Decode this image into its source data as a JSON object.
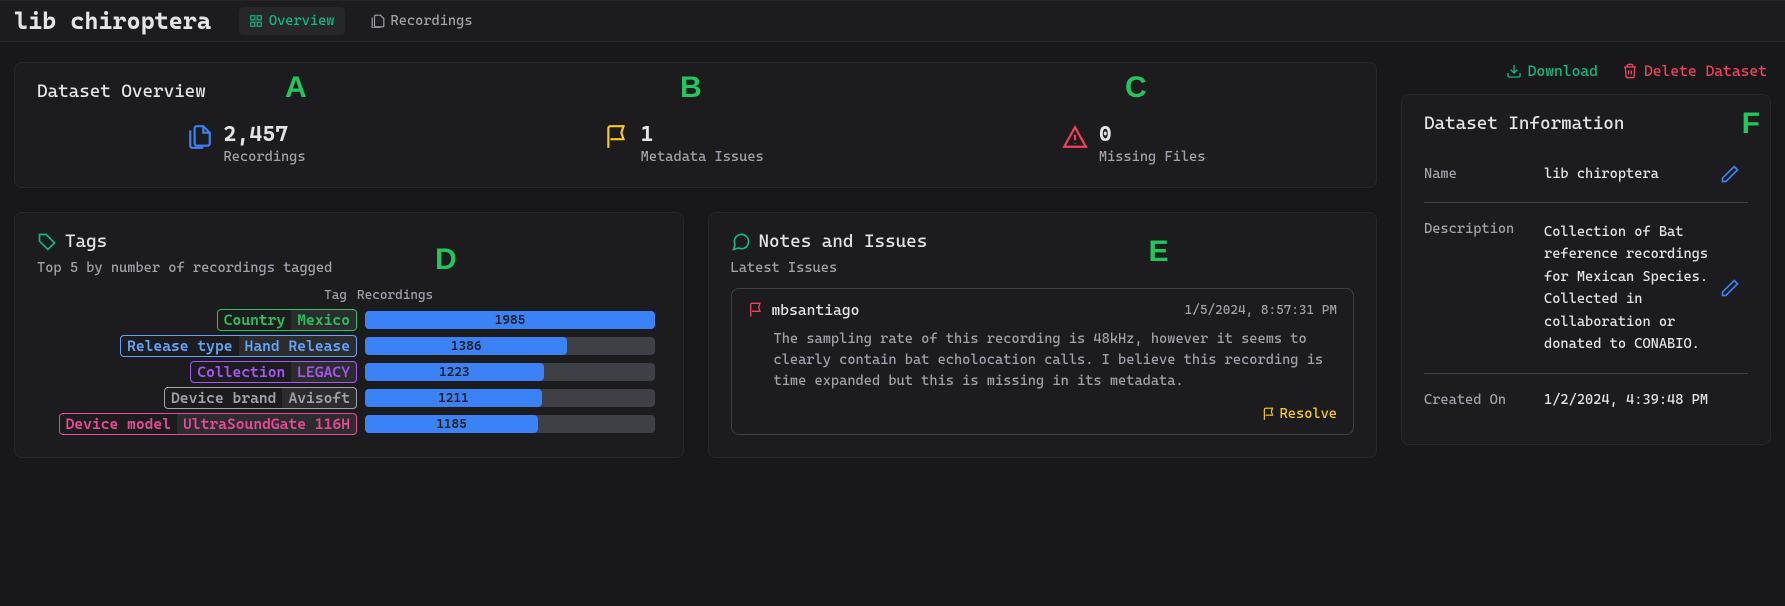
{
  "header": {
    "title": "lib chiroptera",
    "tabs": [
      {
        "label": "Overview",
        "active": true
      },
      {
        "label": "Recordings",
        "active": false
      }
    ]
  },
  "overview": {
    "title": "Dataset Overview",
    "stats": [
      {
        "value": "2,457",
        "label": "Recordings"
      },
      {
        "value": "1",
        "label": "Metadata Issues"
      },
      {
        "value": "0",
        "label": "Missing Files"
      }
    ]
  },
  "tags": {
    "title": "Tags",
    "subtitle": "Top 5 by number of recordings tagged",
    "col_tag": "Tag",
    "col_rec": "Recordings",
    "items": [
      {
        "key": "Country",
        "val": "Mexico",
        "count": 1985,
        "color": "#22c55e"
      },
      {
        "key": "Release type",
        "val": "Hand Release",
        "count": 1386,
        "color": "#60a5fa"
      },
      {
        "key": "Collection",
        "val": "LEGACY",
        "count": 1223,
        "color": "#a855f7"
      },
      {
        "key": "Device brand",
        "val": "Avisoft",
        "count": 1211,
        "color": "#a1a1aa"
      },
      {
        "key": "Device model",
        "val": "UltraSoundGate 116H",
        "count": 1185,
        "color": "#ec4899"
      }
    ]
  },
  "notes": {
    "title": "Notes and Issues",
    "subtitle": "Latest Issues",
    "issue": {
      "user": "mbsantiago",
      "date": "1/5/2024, 8:57:31 PM",
      "body": "The sampling rate of this recording is 48kHz, however it seems to clearly contain bat echolocation calls. I believe this recording is time expanded but this is missing in its metadata.",
      "resolve": "Resolve"
    }
  },
  "actions": {
    "download": "Download",
    "delete": "Delete Dataset"
  },
  "info": {
    "title": "Dataset Information",
    "name_label": "Name",
    "name_value": "lib chiroptera",
    "desc_label": "Description",
    "desc_value": "Collection of Bat reference recordings for Mexican Species. Collected in collaboration or donated to CONABIO.",
    "created_label": "Created On",
    "created_value": "1/2/2024, 4:39:48 PM"
  },
  "markers": {
    "A": "A",
    "B": "B",
    "C": "C",
    "D": "D",
    "E": "E",
    "F": "F"
  },
  "chart_data": {
    "type": "bar",
    "orientation": "horizontal",
    "title": "Top 5 by number of recordings tagged",
    "xlabel": "Recordings",
    "ylabel": "Tag",
    "xlim": [
      0,
      1985
    ],
    "categories": [
      "Country: Mexico",
      "Release type: Hand Release",
      "Collection: LEGACY",
      "Device brand: Avisoft",
      "Device model: UltraSoundGate 116H"
    ],
    "values": [
      1985,
      1386,
      1223,
      1211,
      1185
    ]
  }
}
